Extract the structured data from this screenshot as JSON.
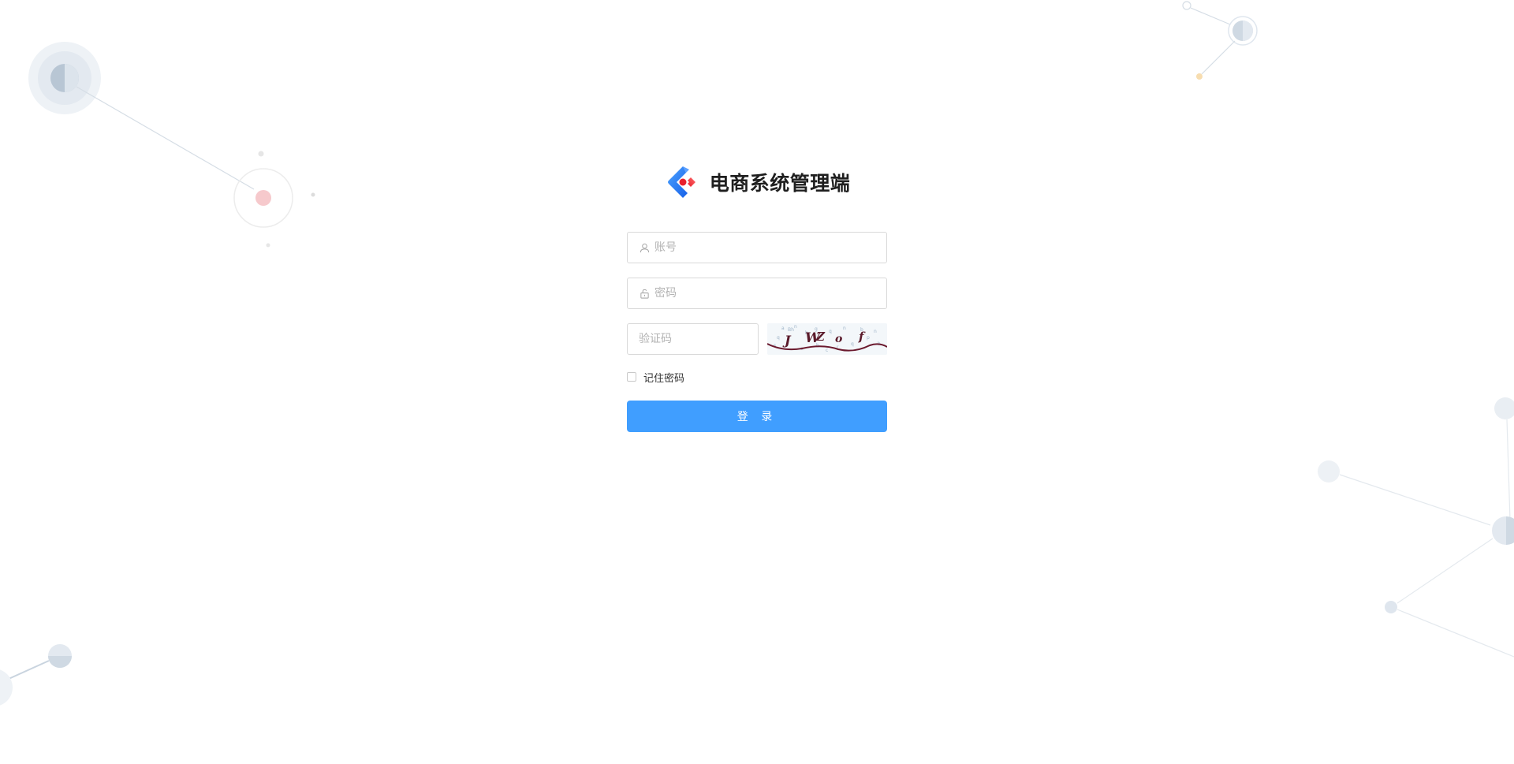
{
  "brand": {
    "title": "电商系统管理端",
    "logo": "diamond-logo",
    "accent_blue": "#1677ff",
    "accent_red": "#f5222d"
  },
  "form": {
    "account": {
      "placeholder": "账号",
      "value": "",
      "icon": "user-icon"
    },
    "password": {
      "placeholder": "密码",
      "value": "",
      "icon": "lock-icon"
    },
    "captcha": {
      "placeholder": "验证码",
      "value": "",
      "image_text": "J WZ o f"
    },
    "remember": {
      "label": "记住密码",
      "checked": false
    },
    "submit": {
      "label": "登 录",
      "color": "#409eff"
    }
  }
}
